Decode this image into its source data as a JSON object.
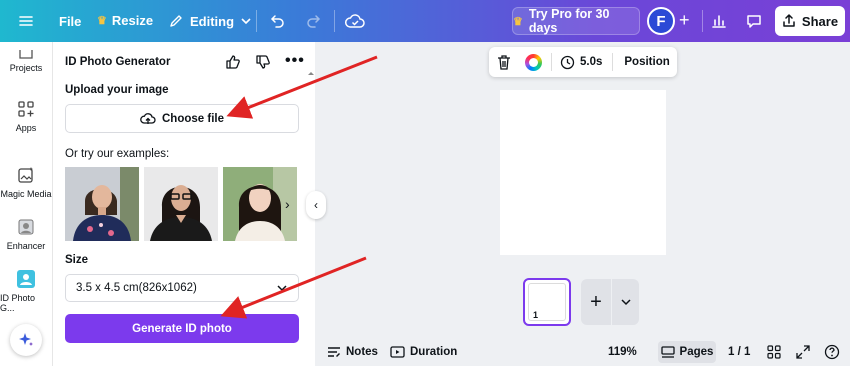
{
  "topbar": {
    "file_label": "File",
    "resize_label": "Resize",
    "editing_label": "Editing",
    "pro_label": "Try Pro for 30 days",
    "avatar_letter": "F",
    "share_label": "Share"
  },
  "rail": {
    "items": [
      {
        "label": "Projects",
        "icon": "folder-icon"
      },
      {
        "label": "Apps",
        "icon": "apps-icon"
      },
      {
        "label": "Magic Media",
        "icon": "magic-media-icon"
      },
      {
        "label": "Enhancer",
        "icon": "enhancer-icon"
      },
      {
        "label": "ID Photo G...",
        "icon": "id-photo-icon"
      }
    ]
  },
  "panel": {
    "title": "ID Photo Generator",
    "upload_label": "Upload your image",
    "choose_file_label": "Choose file",
    "examples_label": "Or try our examples:",
    "size_label": "Size",
    "size_value": "3.5 x 4.5 cm(826x1062)",
    "generate_label": "Generate ID photo"
  },
  "canvas": {
    "duration_label": "5.0s",
    "position_label": "Position",
    "page_number": "1"
  },
  "bottom": {
    "notes_label": "Notes",
    "duration_label": "Duration",
    "zoom": "119%",
    "pages_label": "Pages",
    "page_count": "1 / 1"
  },
  "colors": {
    "accent": "#7c3aed",
    "arrow": "#e02424"
  }
}
